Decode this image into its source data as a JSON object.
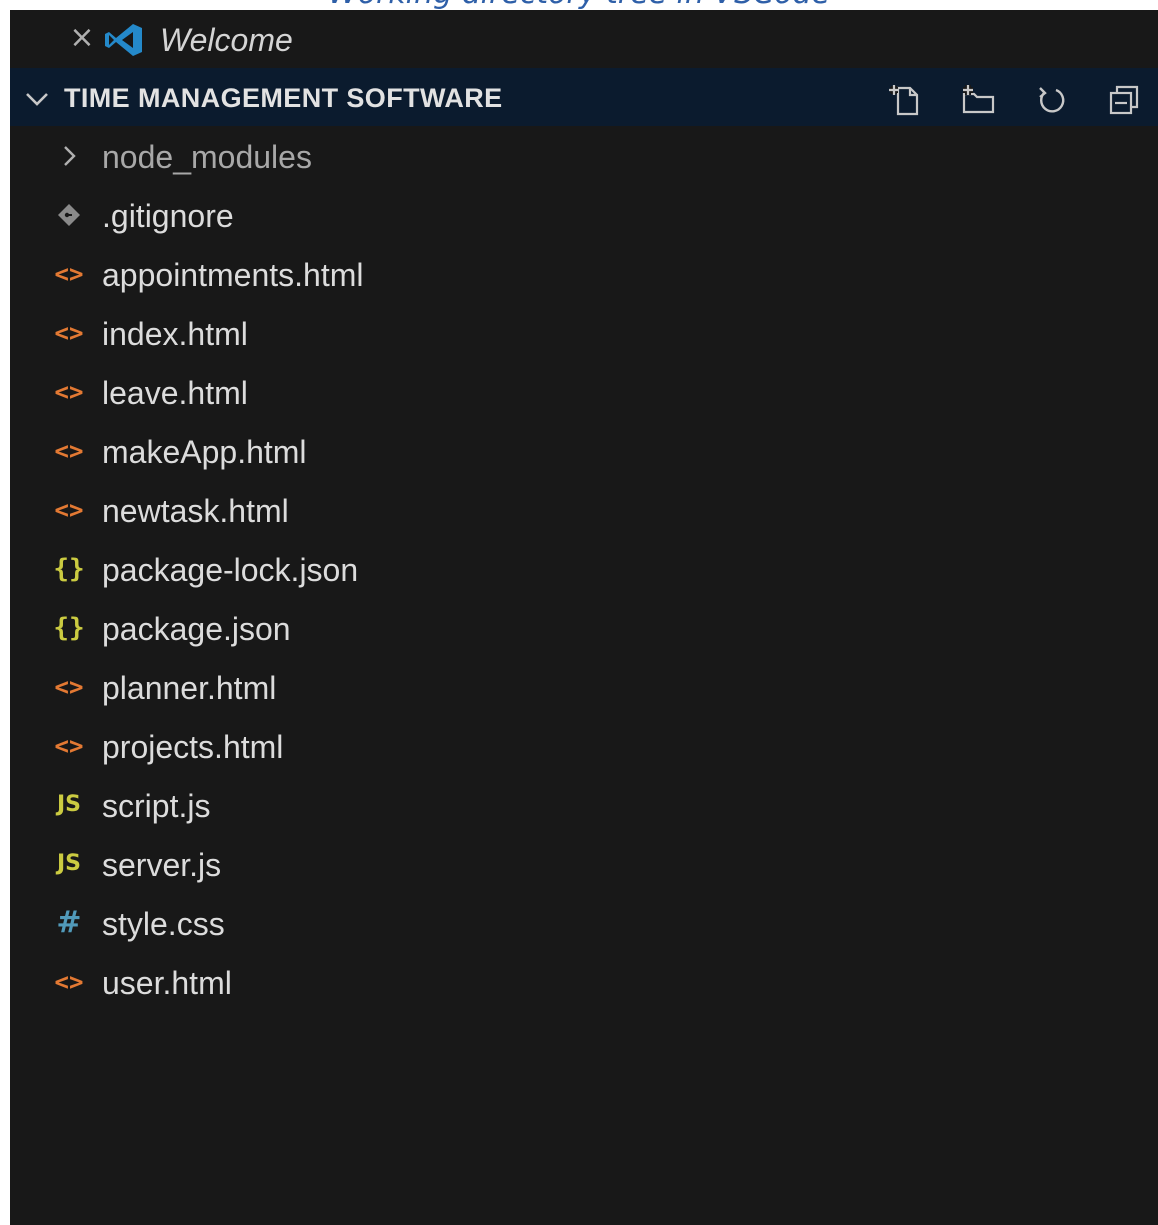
{
  "caption": "Working directory tree in VSCode",
  "tab": {
    "close_glyph": "×",
    "logo_icon": "vscode-logo-icon",
    "title": "Welcome"
  },
  "explorer": {
    "section_title": "TIME MANAGEMENT SOFTWARE",
    "actions": [
      {
        "icon": "new-file-icon"
      },
      {
        "icon": "new-folder-icon"
      },
      {
        "icon": "refresh-icon"
      },
      {
        "icon": "collapse-all-icon"
      }
    ],
    "items": [
      {
        "name": "node_modules",
        "kind": "folder",
        "icon": "chevron-right-icon",
        "glyph": ""
      },
      {
        "name": ".gitignore",
        "kind": "git",
        "icon": "git-icon",
        "glyph": ""
      },
      {
        "name": "appointments.html",
        "kind": "html",
        "icon": "html-file-icon",
        "glyph": "<>"
      },
      {
        "name": "index.html",
        "kind": "html",
        "icon": "html-file-icon",
        "glyph": "<>"
      },
      {
        "name": "leave.html",
        "kind": "html",
        "icon": "html-file-icon",
        "glyph": "<>"
      },
      {
        "name": "makeApp.html",
        "kind": "html",
        "icon": "html-file-icon",
        "glyph": "<>"
      },
      {
        "name": "newtask.html",
        "kind": "html",
        "icon": "html-file-icon",
        "glyph": "<>"
      },
      {
        "name": "package-lock.json",
        "kind": "json",
        "icon": "json-file-icon",
        "glyph": "{}"
      },
      {
        "name": "package.json",
        "kind": "json",
        "icon": "json-file-icon",
        "glyph": "{}"
      },
      {
        "name": "planner.html",
        "kind": "html",
        "icon": "html-file-icon",
        "glyph": "<>"
      },
      {
        "name": "projects.html",
        "kind": "html",
        "icon": "html-file-icon",
        "glyph": "<>"
      },
      {
        "name": "script.js",
        "kind": "js",
        "icon": "js-file-icon",
        "glyph": "JS"
      },
      {
        "name": "server.js",
        "kind": "js",
        "icon": "js-file-icon",
        "glyph": "JS"
      },
      {
        "name": "style.css",
        "kind": "css",
        "icon": "css-file-icon",
        "glyph": "#"
      },
      {
        "name": "user.html",
        "kind": "html",
        "icon": "html-file-icon",
        "glyph": "<>"
      }
    ]
  },
  "colors": {
    "background": "#181818",
    "header_background": "#0b1b2e",
    "html_icon": "#e37933",
    "json_icon": "#cbcb41",
    "js_icon": "#cbcb41",
    "css_icon": "#519aba",
    "text": "#dcdcdc",
    "caption": "#2e5fa8",
    "vscode_blue": "#2489ca"
  }
}
